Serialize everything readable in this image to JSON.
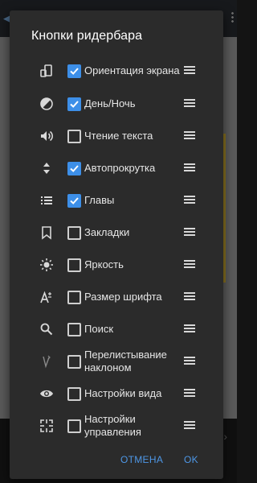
{
  "dialog": {
    "title": "Кнопки ридербара",
    "items": [
      {
        "label": "Ориентация экрана",
        "checked": true,
        "icon": "screen-rotation-icon"
      },
      {
        "label": "День/Ночь",
        "checked": true,
        "icon": "contrast-icon"
      },
      {
        "label": "Чтение текста",
        "checked": false,
        "icon": "volume-icon"
      },
      {
        "label": "Автопрокрутка",
        "checked": true,
        "icon": "autoscroll-icon"
      },
      {
        "label": "Главы",
        "checked": true,
        "icon": "list-icon"
      },
      {
        "label": "Закладки",
        "checked": false,
        "icon": "bookmark-icon"
      },
      {
        "label": "Яркость",
        "checked": false,
        "icon": "brightness-icon"
      },
      {
        "label": "Размер шрифта",
        "checked": false,
        "icon": "font-size-icon"
      },
      {
        "label": "Поиск",
        "checked": false,
        "icon": "search-icon"
      },
      {
        "label": "Перелистывание наклоном",
        "checked": false,
        "icon": "tilt-icon"
      },
      {
        "label": "Настройки вида",
        "checked": false,
        "icon": "eye-icon"
      },
      {
        "label": "Настройки управления",
        "checked": false,
        "icon": "controls-icon"
      }
    ],
    "cancel_label": "ОТМЕНА",
    "ok_label": "OK"
  },
  "colors": {
    "dialog_bg": "#2b2b2b",
    "accent": "#4e97e6",
    "checkbox_checked": "#3d8fe8"
  }
}
